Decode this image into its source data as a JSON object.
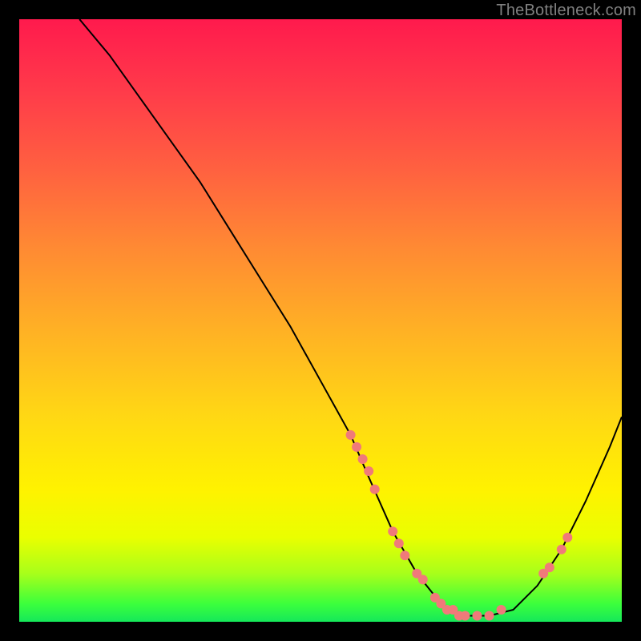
{
  "watermark": "TheBottleneck.com",
  "chart_data": {
    "type": "line",
    "title": "",
    "xlabel": "",
    "ylabel": "",
    "xlim": [
      0,
      100
    ],
    "ylim": [
      0,
      100
    ],
    "curve": {
      "x": [
        10,
        15,
        20,
        25,
        30,
        35,
        40,
        45,
        50,
        55,
        58,
        62,
        66,
        70,
        74,
        78,
        82,
        86,
        90,
        94,
        98,
        100
      ],
      "y": [
        100,
        94,
        87,
        80,
        73,
        65,
        57,
        49,
        40,
        31,
        24,
        15,
        8,
        3,
        1,
        1,
        2,
        6,
        12,
        20,
        29,
        34
      ]
    },
    "markers": {
      "x": [
        55,
        56,
        57,
        58,
        59,
        62,
        63,
        64,
        66,
        67,
        69,
        70,
        71,
        72,
        73,
        74,
        76,
        78,
        80,
        87,
        88,
        90,
        91
      ],
      "y": [
        31,
        29,
        27,
        25,
        22,
        15,
        13,
        11,
        8,
        7,
        4,
        3,
        2,
        2,
        1,
        1,
        1,
        1,
        2,
        8,
        9,
        12,
        14
      ]
    },
    "marker_color": "#f07a7a",
    "gradient_stops": [
      {
        "pos": 0,
        "color": "#ff1a4d"
      },
      {
        "pos": 50,
        "color": "#ffb224"
      },
      {
        "pos": 80,
        "color": "#fff200"
      },
      {
        "pos": 100,
        "color": "#15e85a"
      }
    ]
  }
}
